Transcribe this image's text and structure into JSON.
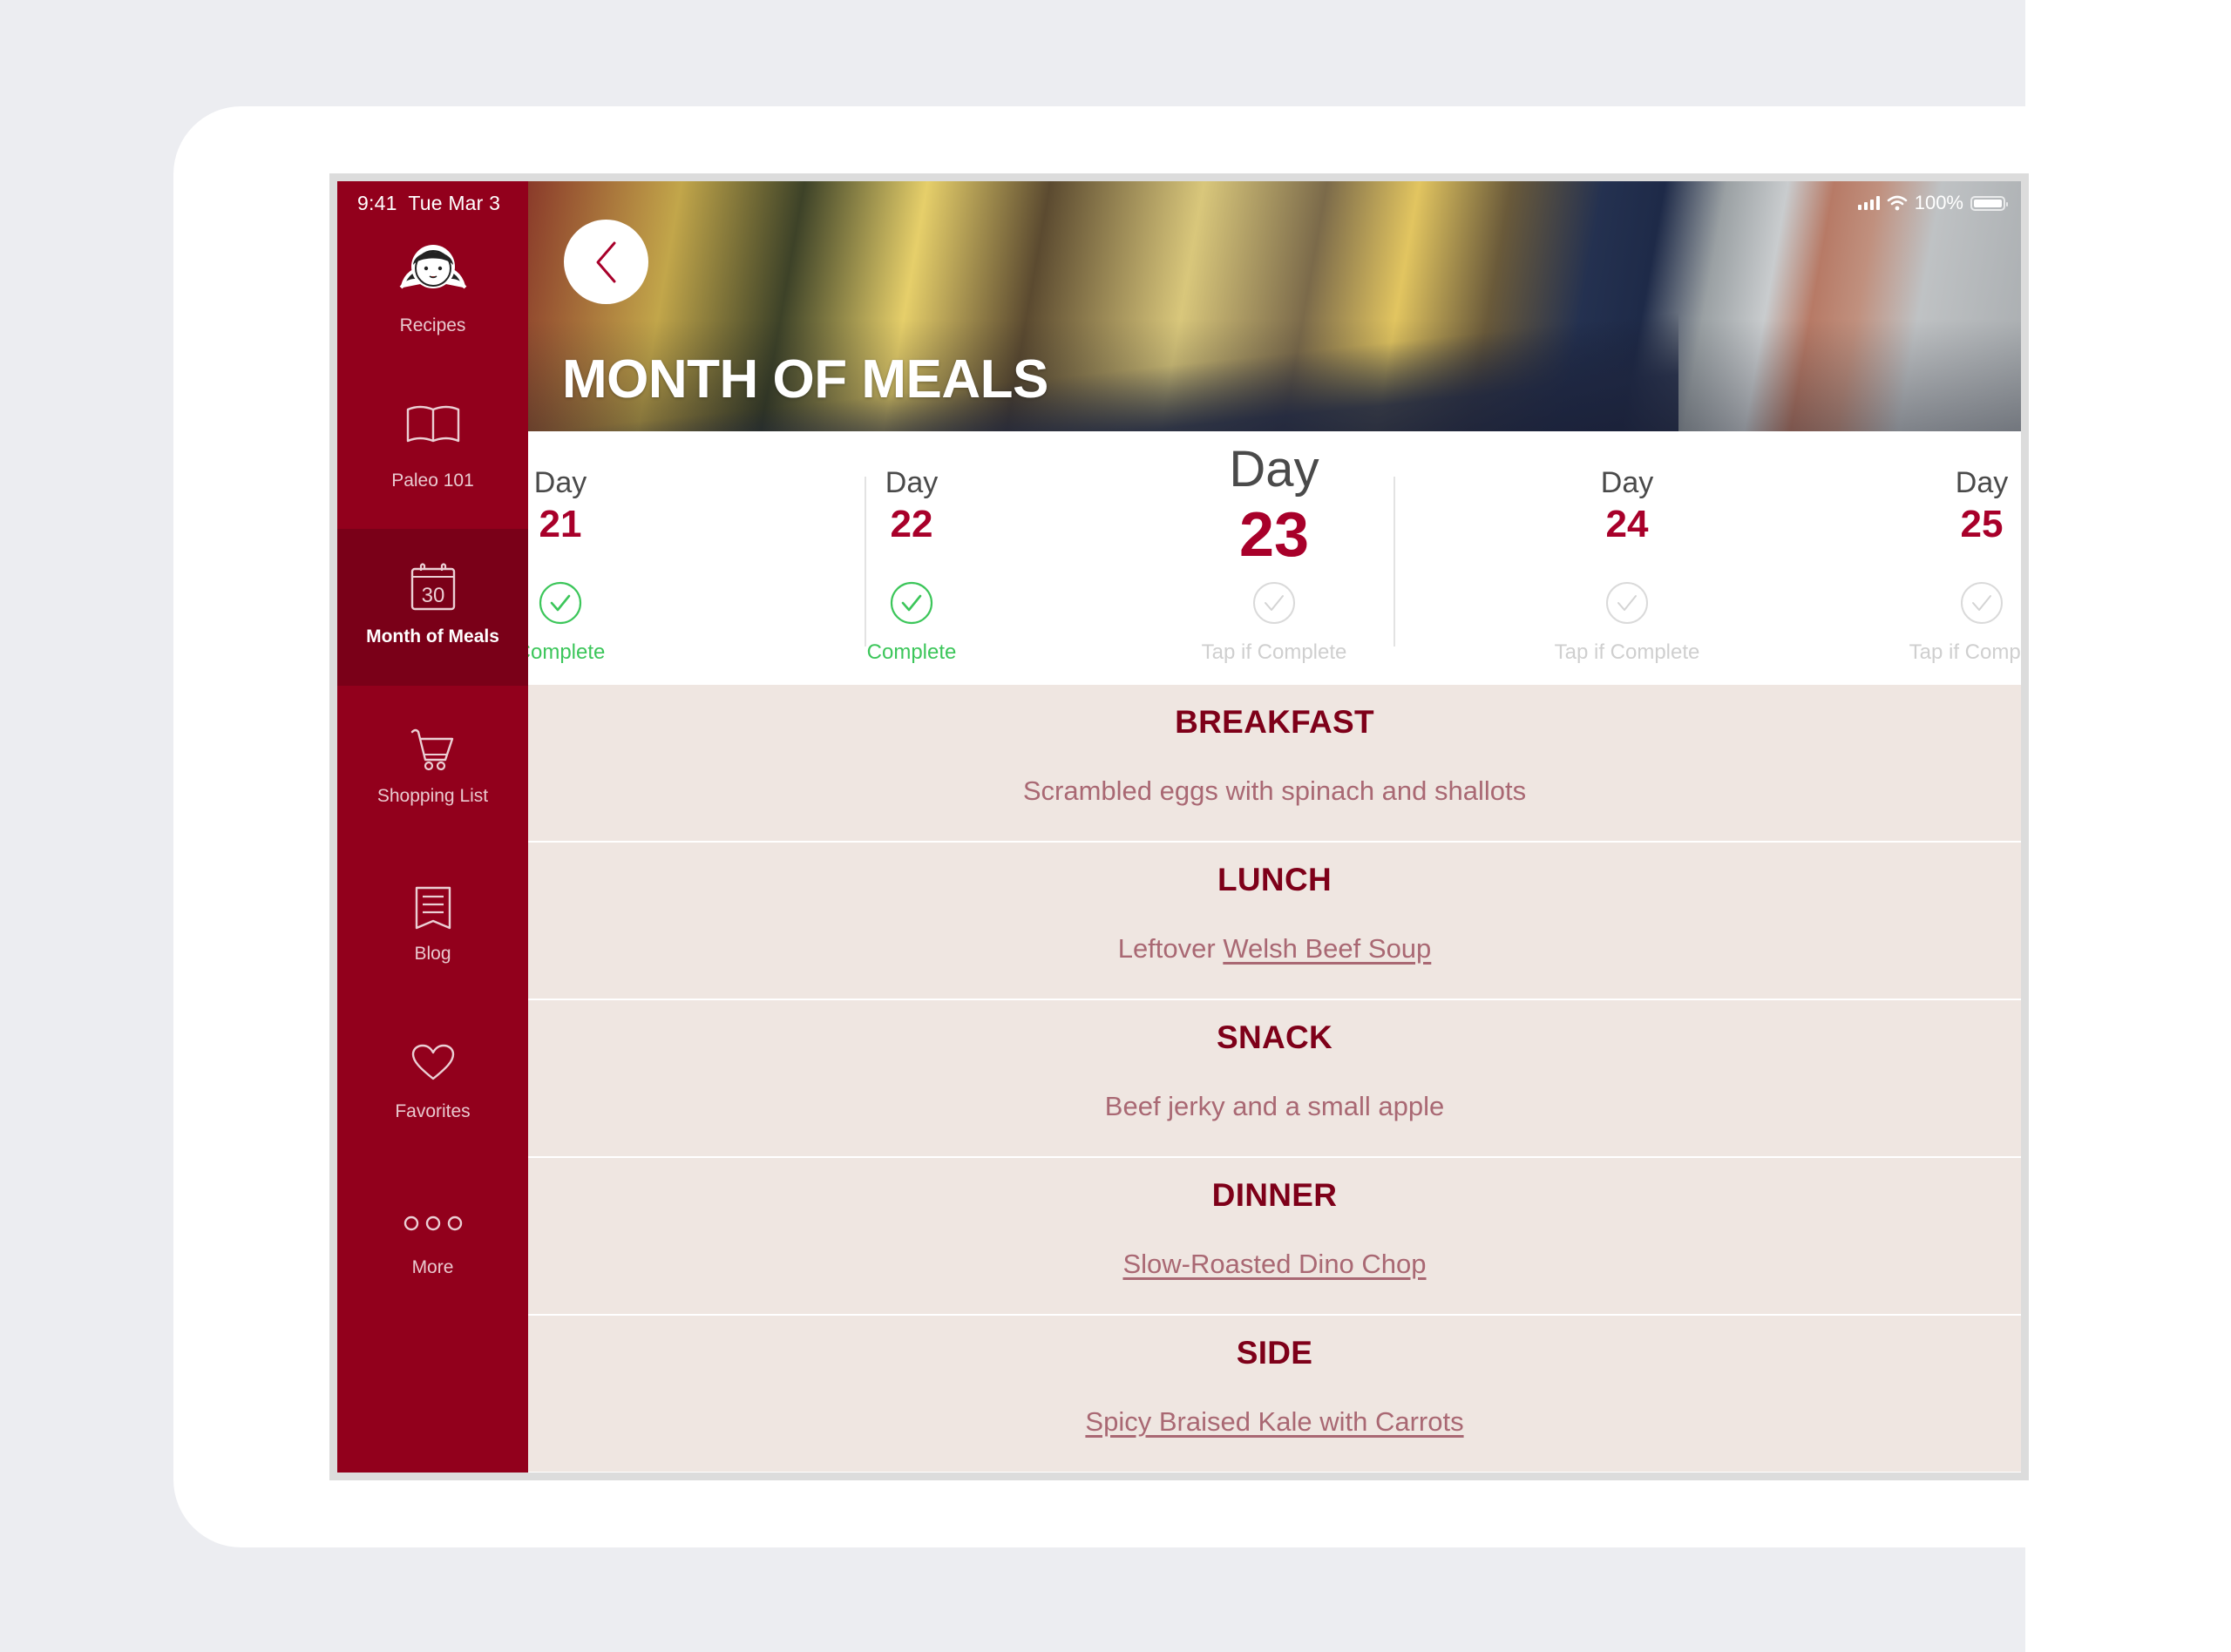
{
  "status_bar": {
    "time": "9:41",
    "date": "Tue Mar 3",
    "battery_percent": "100%"
  },
  "sidebar": {
    "items": [
      {
        "label": "Recipes",
        "icon": "girl-face-logo-icon",
        "active": false
      },
      {
        "label": "Paleo 101",
        "icon": "open-book-icon",
        "active": false
      },
      {
        "label": "Month of Meals",
        "icon": "calendar-icon",
        "icon_text": "30",
        "active": true
      },
      {
        "label": "Shopping List",
        "icon": "shopping-cart-icon",
        "active": false
      },
      {
        "label": "Blog",
        "icon": "bookmark-list-icon",
        "active": false
      },
      {
        "label": "Favorites",
        "icon": "heart-icon",
        "active": false
      },
      {
        "label": "More",
        "icon": "more-dots-icon",
        "active": false
      }
    ]
  },
  "header": {
    "title": "MONTH OF MEALS",
    "back_icon": "chevron-left-icon"
  },
  "days": [
    {
      "word": "Day",
      "number": "21",
      "status": "Complete",
      "completed": true,
      "current": false
    },
    {
      "word": "Day",
      "number": "22",
      "status": "Complete",
      "completed": true,
      "current": false
    },
    {
      "word": "Day",
      "number": "23",
      "status": "Tap if Complete",
      "completed": false,
      "current": true
    },
    {
      "word": "Day",
      "number": "24",
      "status": "Tap if Complete",
      "completed": false,
      "current": false
    },
    {
      "word": "Day",
      "number": "25",
      "status": "Tap if Complete",
      "completed": false,
      "current": false
    }
  ],
  "meals": [
    {
      "title": "BREAKFAST",
      "prefix": "",
      "text": "Scrambled eggs with spinach and shallots",
      "link": ""
    },
    {
      "title": "LUNCH",
      "prefix": "Leftover ",
      "text": "",
      "link": "Welsh Beef Soup"
    },
    {
      "title": "SNACK",
      "prefix": "",
      "text": "Beef jerky and a small apple",
      "link": ""
    },
    {
      "title": "DINNER",
      "prefix": "",
      "text": "",
      "link": "Slow-Roasted Dino Chop"
    },
    {
      "title": "SIDE",
      "prefix": "",
      "text": "",
      "link": "Spicy Braised Kale with Carrots"
    }
  ],
  "colors": {
    "brand_red": "#92001C",
    "active_nav": "#7A0018",
    "day_number": "#A8002A",
    "complete_green": "#3CC65A",
    "meal_background": "#EFE6E1"
  }
}
